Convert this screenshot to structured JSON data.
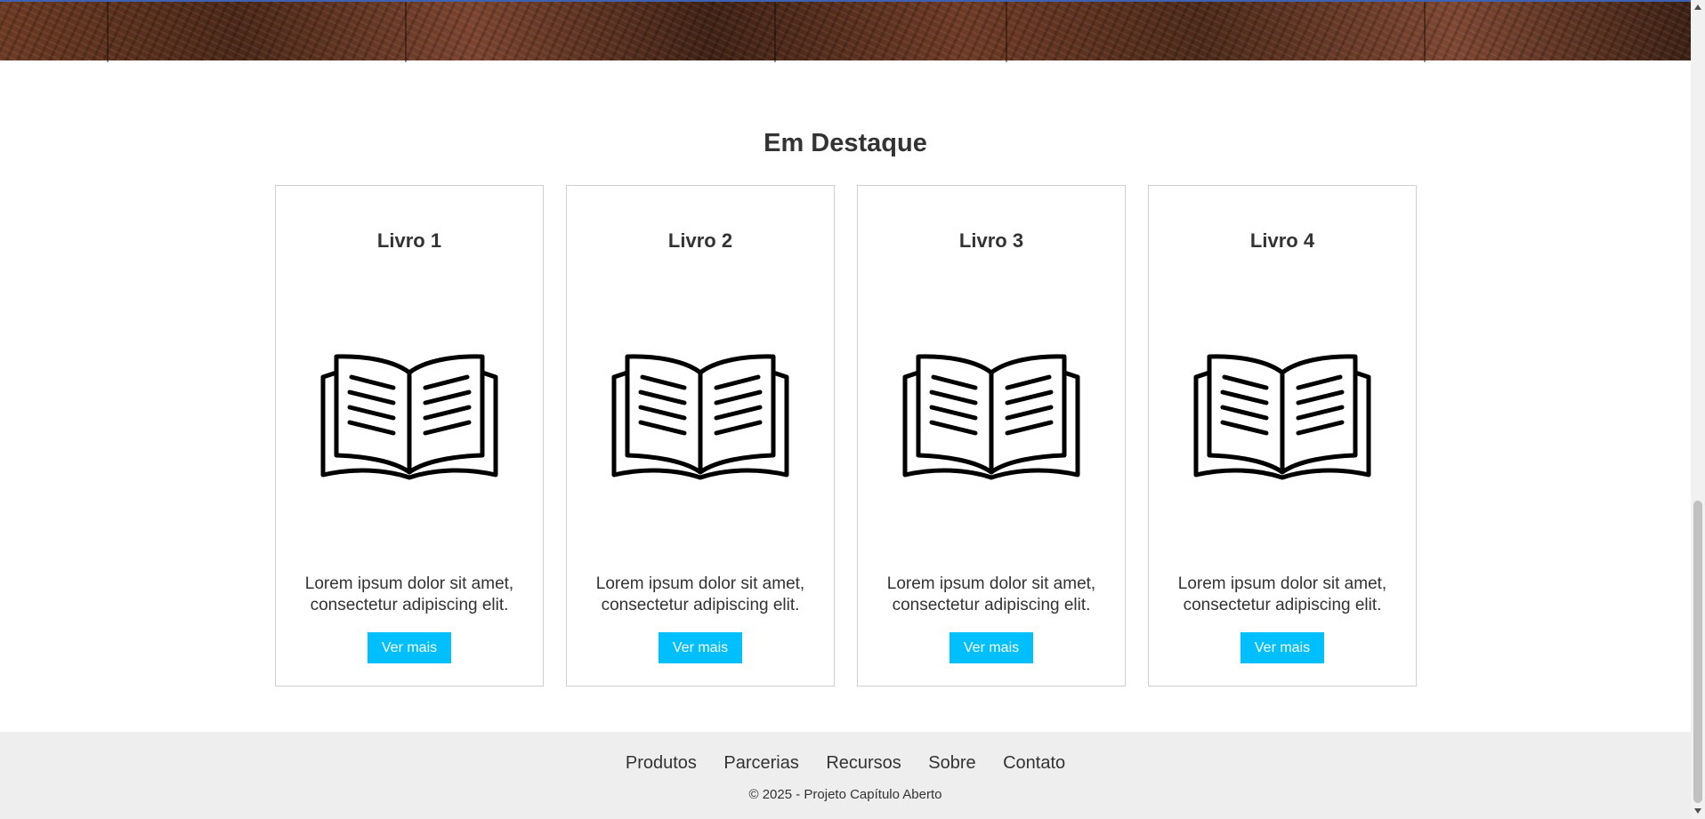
{
  "featured": {
    "title": "Em Destaque",
    "cards": [
      {
        "title": "Livro 1",
        "description": "Lorem ipsum dolor sit amet, consectetur adipiscing elit.",
        "button_label": "Ver mais",
        "icon": "open-book-icon"
      },
      {
        "title": "Livro 2",
        "description": "Lorem ipsum dolor sit amet, consectetur adipiscing elit.",
        "button_label": "Ver mais",
        "icon": "open-book-icon"
      },
      {
        "title": "Livro 3",
        "description": "Lorem ipsum dolor sit amet, consectetur adipiscing elit.",
        "button_label": "Ver mais",
        "icon": "open-book-icon"
      },
      {
        "title": "Livro 4",
        "description": "Lorem ipsum dolor sit amet, consectetur adipiscing elit.",
        "button_label": "Ver mais",
        "icon": "open-book-icon"
      }
    ]
  },
  "footer": {
    "links": [
      "Produtos",
      "Parcerias",
      "Recursos",
      "Sobre",
      "Contato"
    ],
    "copyright": "© 2025 - Projeto Capítulo Aberto"
  },
  "colors": {
    "accent_button": "#00bfff",
    "footer_background": "#eeeeee",
    "text": "#333333"
  }
}
